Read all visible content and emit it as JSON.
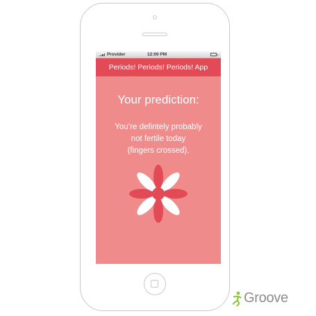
{
  "status_bar": {
    "provider": "Provider",
    "time": "12:00 PM"
  },
  "app_bar": {
    "title": "Periods! Periods! Periods! App"
  },
  "prediction": {
    "heading": "Your prediction:",
    "message_lines": [
      "You’re defintely probably",
      "not fertile today",
      "(fingers crossed)."
    ]
  },
  "flower": {
    "icon": "flower-icon",
    "petal_colors": [
      "#e24b56",
      "#ffffff"
    ],
    "center_color": "#e24b56"
  },
  "brand": {
    "name": "Groove",
    "logo_icon": "groove-logo-icon",
    "color": "#8c8c8c",
    "accent_color": "#8dc63f"
  },
  "colors": {
    "screen_background": "#ef8b8b",
    "app_bar_background": "#e24b56",
    "device_outline": "#c9c9c9"
  }
}
